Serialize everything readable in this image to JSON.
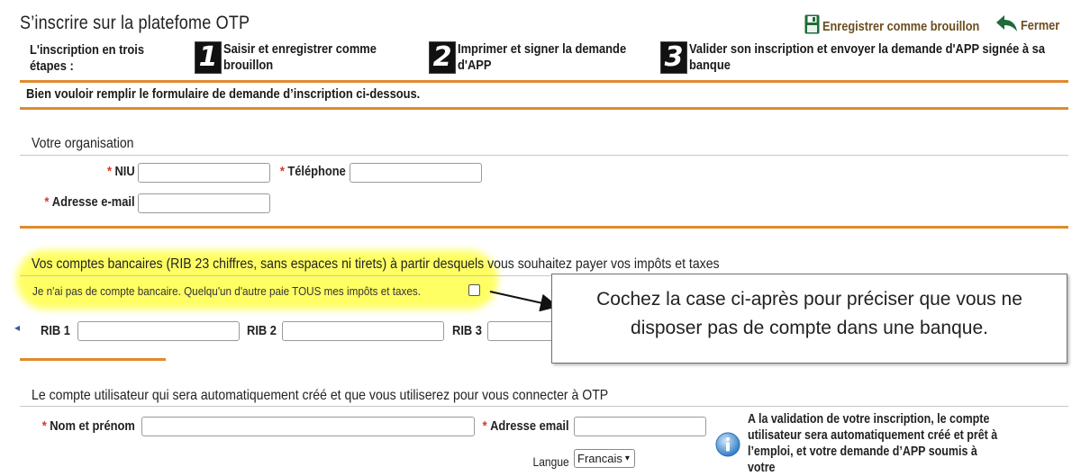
{
  "page": {
    "title": "S’inscrire sur la platefome OTP",
    "save_draft": "Enregistrer comme brouillon",
    "close": "Fermer"
  },
  "steps": {
    "label": "L'inscription en trois étapes :",
    "items": [
      {
        "num": "1",
        "text_line1": "Saisir et enregistrer comme",
        "text_line2": "brouillon"
      },
      {
        "num": "2",
        "text_line1": "Imprimer et signer la demande",
        "text_line2": "d'APP"
      },
      {
        "num": "3",
        "text_line1": "Valider son inscription et envoyer la demande d'APP signée à sa",
        "text_line2": "banque"
      }
    ]
  },
  "lead": "Bien vouloir remplir le formulaire de demande d’inscription ci-dessous.",
  "organisation": {
    "title": "Votre organisation",
    "niu_label": "NIU",
    "phone_label": "Téléphone",
    "email_label": "Adresse e-mail"
  },
  "bank": {
    "title": "Vos comptes bancaires (RIB 23 chiffres, sans espaces ni tirets) à partir desquels vous souhaitez payer vos impôts et taxes",
    "no_account": "Je n'ai pas de compte bancaire. Quelqu'un d'autre paie TOUS mes impôts et taxes.",
    "rib1": "RIB 1",
    "rib2": "RIB 2",
    "rib3": "RIB 3"
  },
  "callout": {
    "line1": "Cochez la case ci-après pour préciser que vous ne",
    "line2": "disposer pas de compte dans une banque."
  },
  "user_account": {
    "title": "Le compte utilisateur qui sera automatiquement créé et que vous utiliserez pour vous connecter à OTP",
    "name_label": "Nom et prénom",
    "email_label": "Adresse email",
    "lang_label": "Langue",
    "lang_value": "Francais",
    "info_line1": "A la validation de votre inscription, le compte",
    "info_line2": "utilisateur sera automatiquement créé et prêt à",
    "info_line3": "l’emploi, et votre demande d’APP soumis à votre"
  },
  "colors": {
    "accent_orange": "#e08a2c",
    "highlight_yellow": "#ffff5c",
    "required_red": "#d23a2a",
    "icon_green": "#1f6b3a"
  }
}
